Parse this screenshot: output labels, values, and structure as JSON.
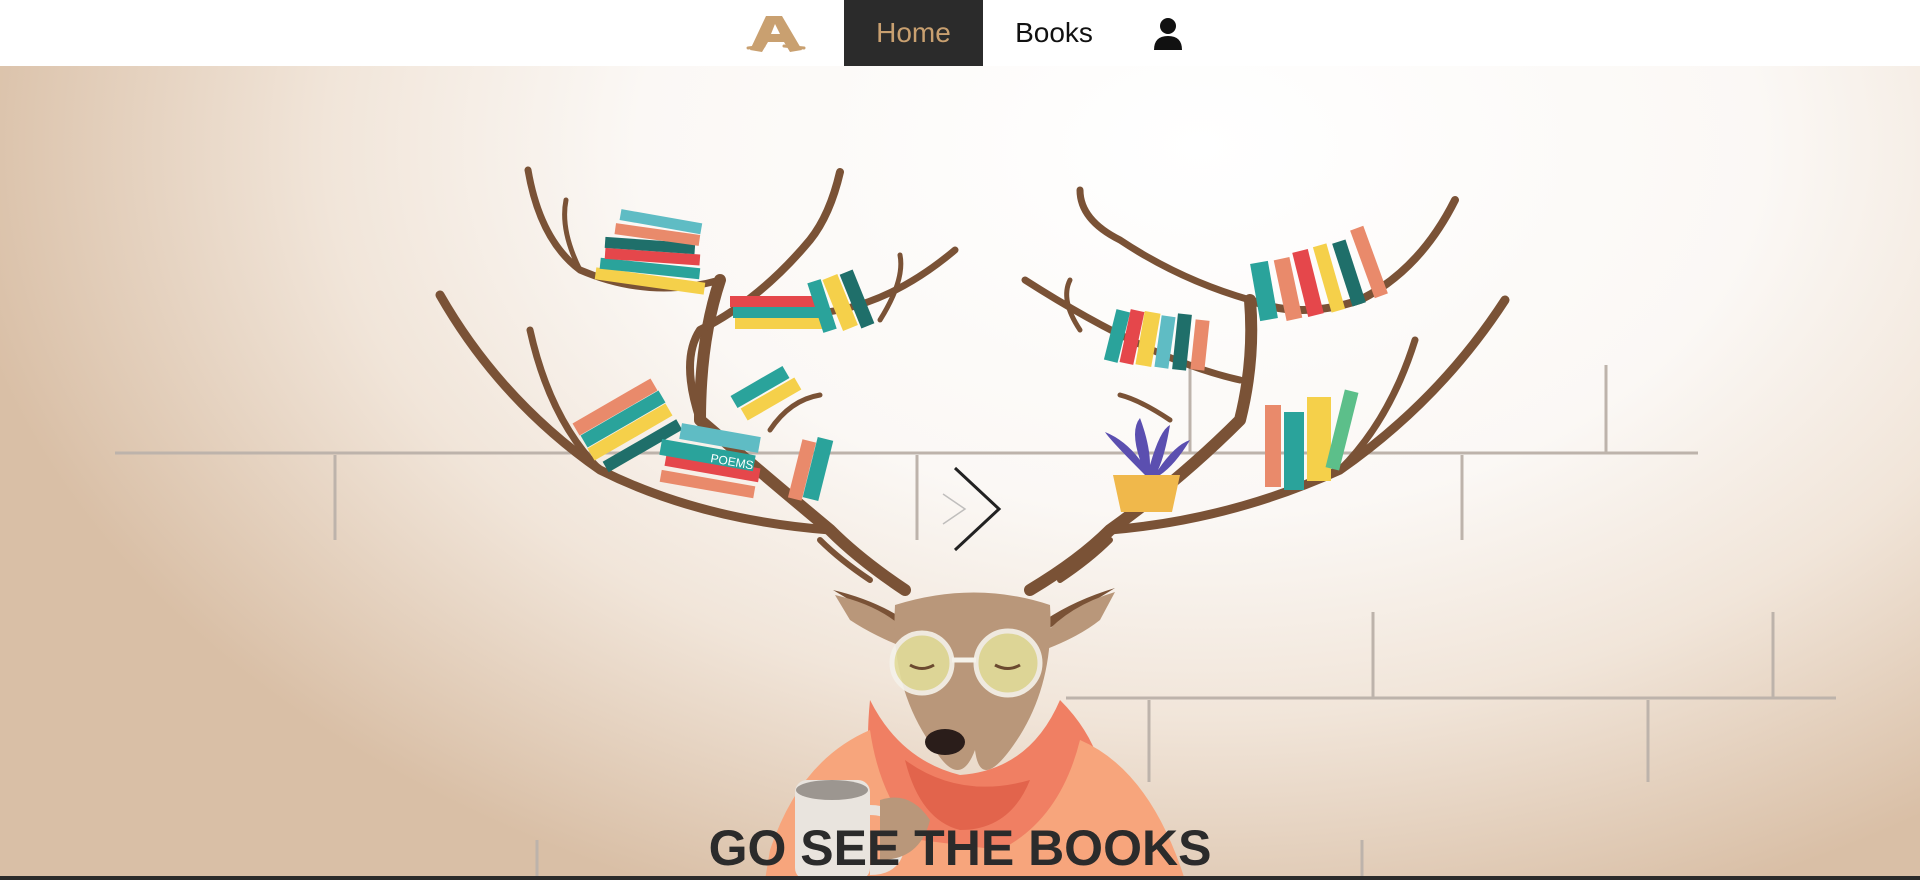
{
  "nav": {
    "logo_icon": "bookstore-logo-icon",
    "home_label": "Home",
    "books_label": "Books",
    "user_icon": "user-icon",
    "accent_color": "#c9a070",
    "active_bg": "#2b2b2b"
  },
  "hero": {
    "illustration": "deer-with-antler-bookshelves",
    "book_spine_text": "POEMS",
    "next_icon": "chevron-right-icon",
    "headline": "GO SEE THE BOOKS"
  }
}
